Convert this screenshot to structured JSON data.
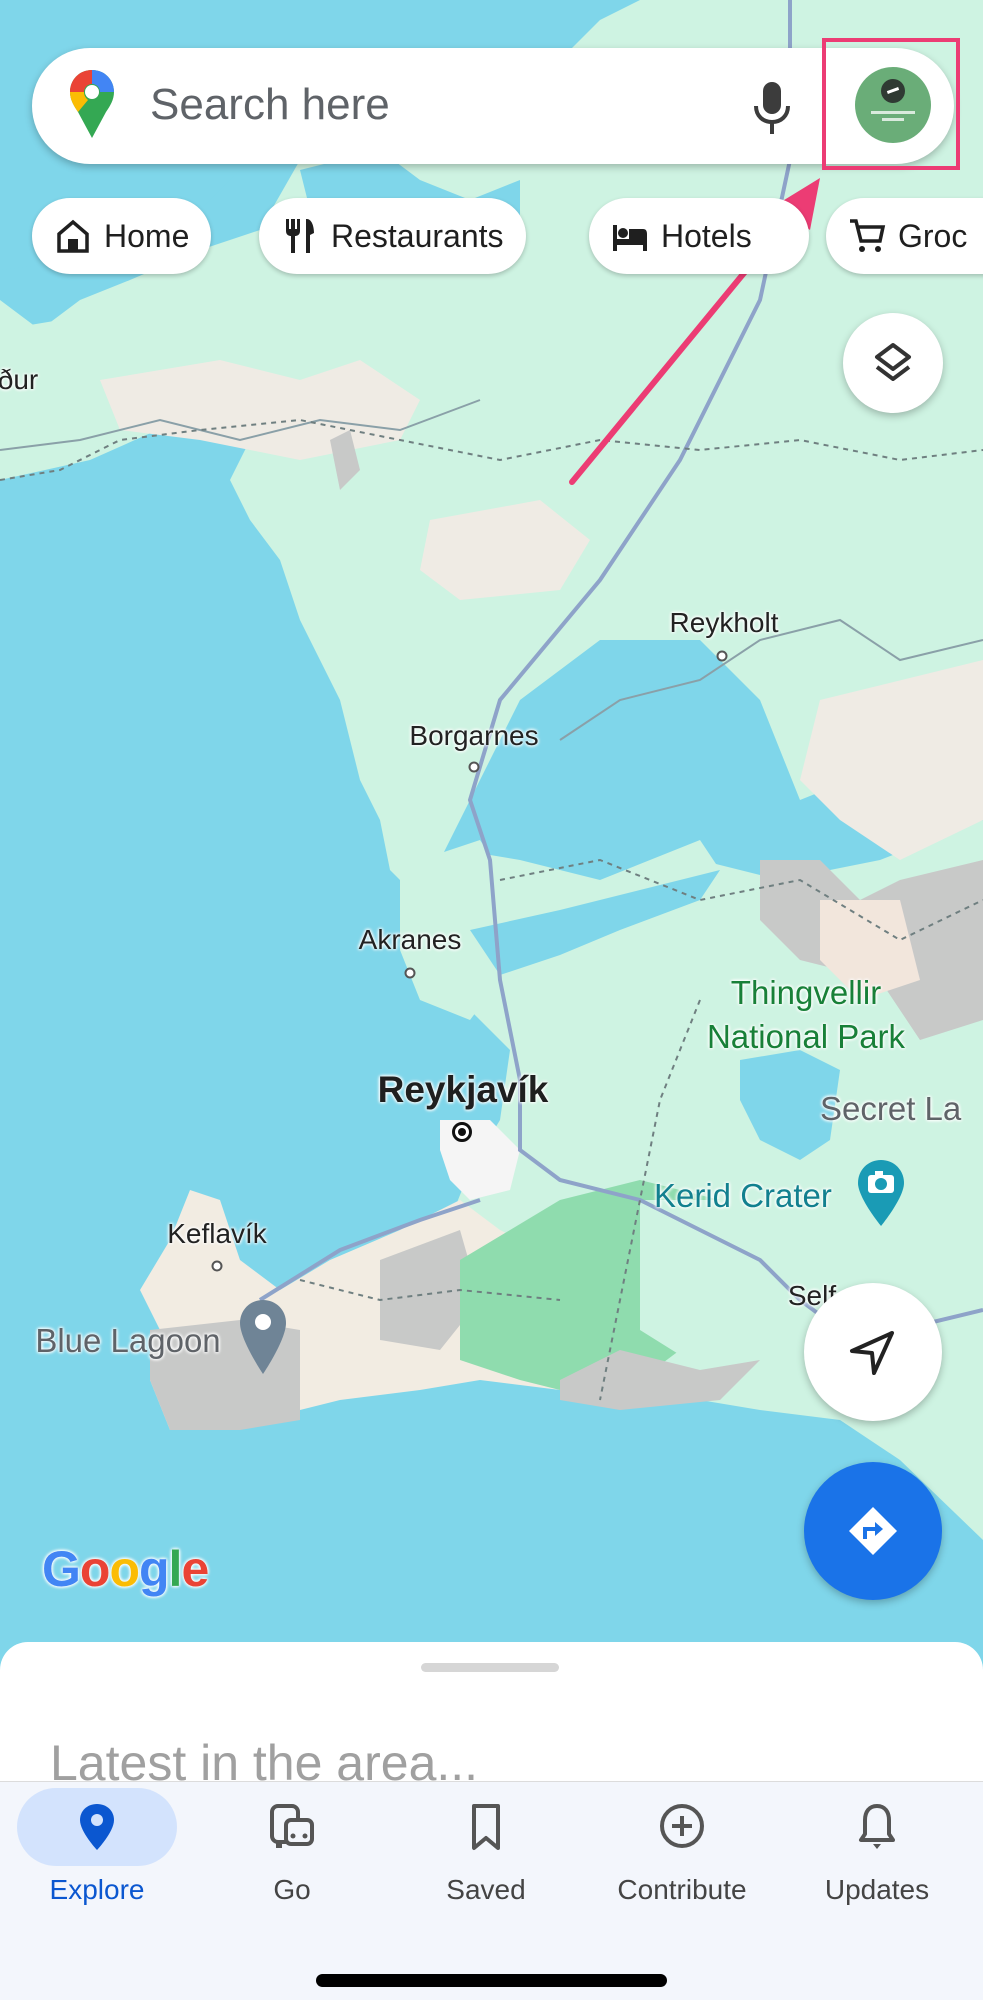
{
  "search": {
    "placeholder": "Search here"
  },
  "chips": [
    {
      "label": "Home",
      "icon": "home-icon"
    },
    {
      "label": "Restaurants",
      "icon": "restaurant-icon"
    },
    {
      "label": "Hotels",
      "icon": "hotel-bed-icon"
    },
    {
      "label": "Groc",
      "icon": "shopping-cart-icon"
    }
  ],
  "map": {
    "labels": {
      "partial_west": "ður",
      "reykholt": "Reykholt",
      "borgarnes": "Borgarnes",
      "akranes": "Akranes",
      "reykjavik": "Reykjavík",
      "thingvellir_1": "Thingvellir",
      "thingvellir_2": "National Park",
      "secret_lagoon": "Secret La",
      "kerid": "Kerid Crater",
      "keflavik": "Keflavík",
      "blue_lagoon": "Blue Lagoon",
      "selfoss": "Self"
    },
    "attribution": "Google"
  },
  "colors": {
    "water": "#7fd6ea",
    "land": "#cef3e2",
    "accent_blue": "#1a73e8",
    "highlight_pink": "#ec3c74",
    "park_green": "#188038",
    "poi_teal": "#12808f"
  },
  "sheet": {
    "title": "Latest in the area..."
  },
  "bottom_nav": [
    {
      "label": "Explore",
      "icon": "explore-pin-icon",
      "active": true
    },
    {
      "label": "Go",
      "icon": "go-commute-icon",
      "active": false
    },
    {
      "label": "Saved",
      "icon": "bookmark-icon",
      "active": false
    },
    {
      "label": "Contribute",
      "icon": "add-circle-icon",
      "active": false
    },
    {
      "label": "Updates",
      "icon": "bell-icon",
      "active": false
    }
  ]
}
